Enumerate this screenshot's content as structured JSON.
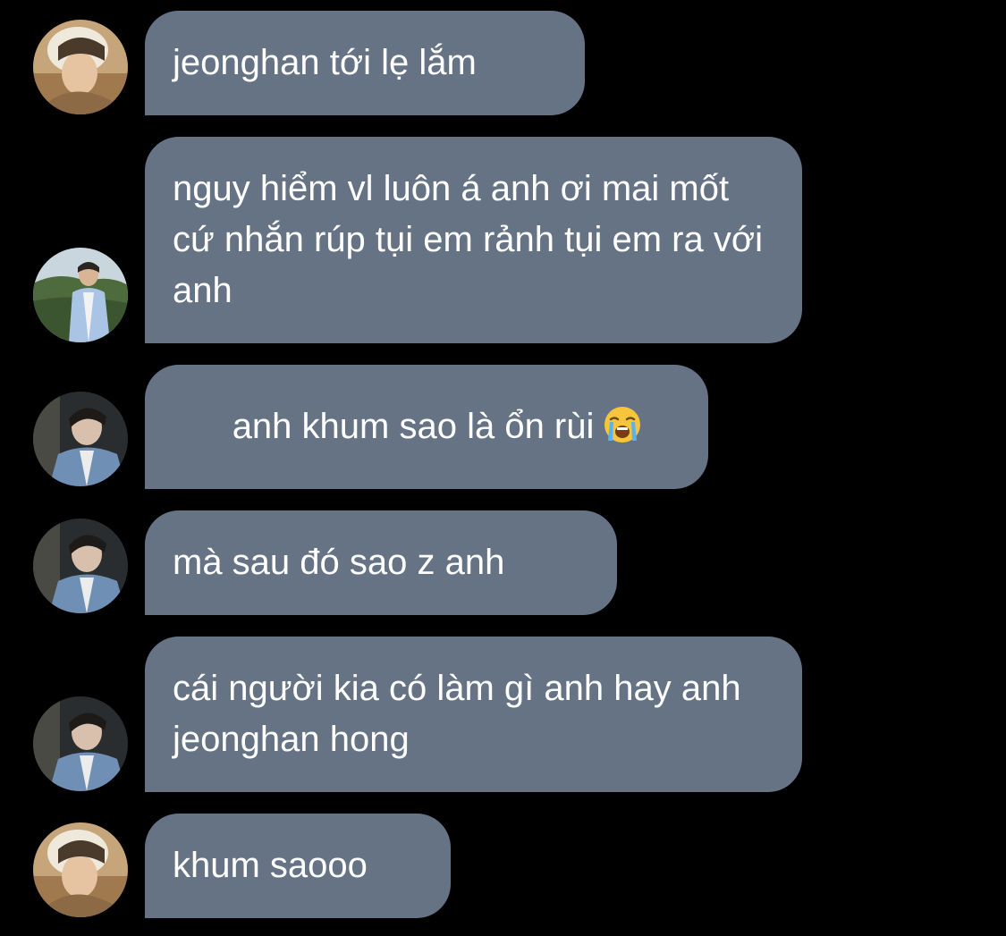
{
  "messages": [
    {
      "id": "m1",
      "text": "jeonghan tới lẹ lắm",
      "avatar": "avatar-hat-person"
    },
    {
      "id": "m2",
      "text": "nguy hiểm vl luôn á anh ơi mai mốt cứ nhắn rúp tụi em rảnh tụi em ra với anh",
      "avatar": "avatar-outdoor-person"
    },
    {
      "id": "m3",
      "text": "anh khum sao là ổn rùi",
      "emoji": "loudly-crying-face-icon",
      "avatar": "avatar-denim-person"
    },
    {
      "id": "m4",
      "text": "mà sau đó sao z anh",
      "avatar": "avatar-denim-person"
    },
    {
      "id": "m5",
      "text": "cái người kia có làm gì anh hay anh jeonghan hong",
      "avatar": "avatar-denim-person"
    },
    {
      "id": "m6",
      "text": "khum saooo",
      "avatar": "avatar-hat-person"
    }
  ],
  "colors": {
    "background": "#000000",
    "bubble": "#667385",
    "text": "#ffffff"
  }
}
